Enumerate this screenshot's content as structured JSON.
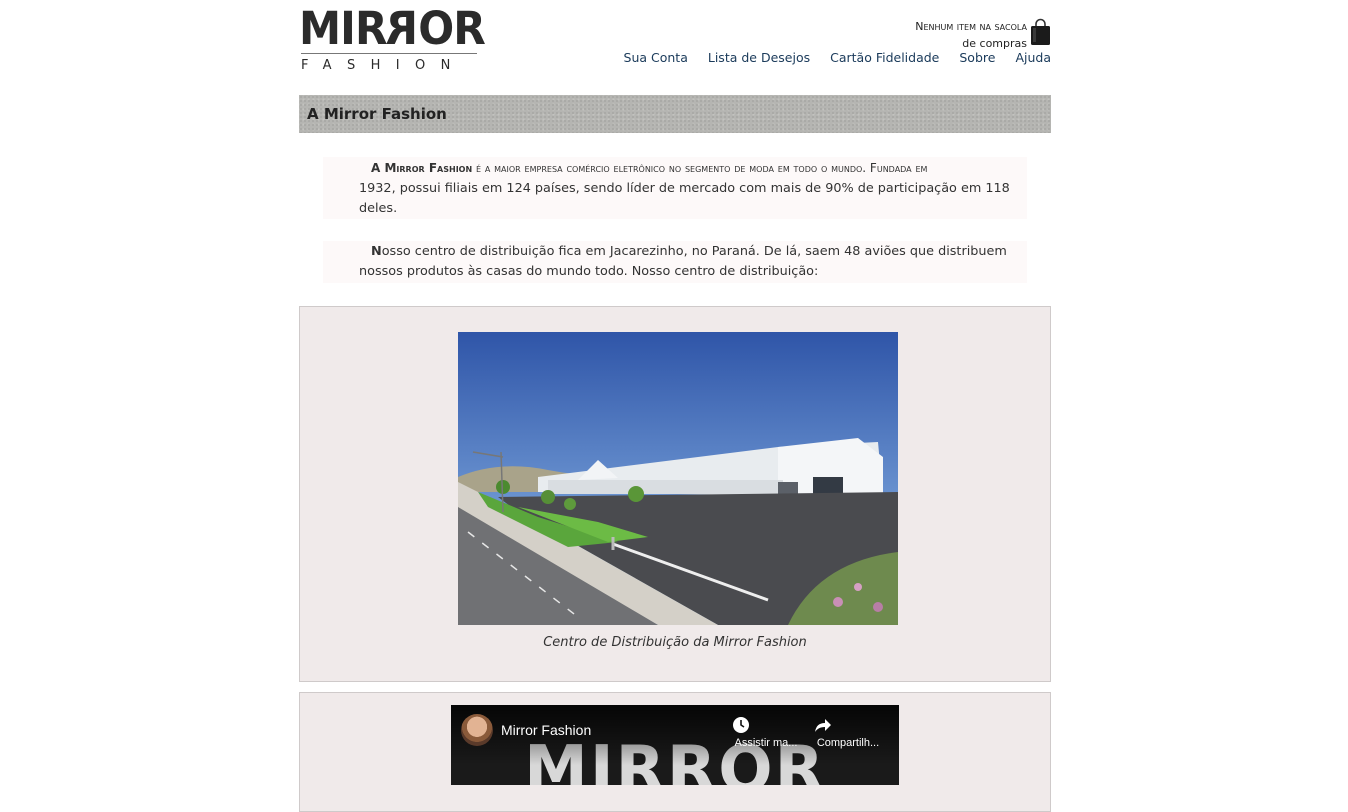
{
  "logo": {
    "top": "MIRROR",
    "bottom": "FASHION"
  },
  "cart": {
    "line1": "Nenhum item na sacola",
    "line2": "de compras"
  },
  "nav": [
    "Sua Conta",
    "Lista de Desejos",
    "Cartão Fidelidade",
    "Sobre",
    "Ajuda"
  ],
  "title": "A Mirror Fashion",
  "para1": {
    "brand": "A Mirror Fashion",
    "sc_text": " é a maior empresa comércio eletrônico no segmento de moda em todo o mundo. Fundada em",
    "rest": "1932, possui filiais em 124 países, sendo líder de mercado com mais de 90% de participação em 118 deles."
  },
  "para2": {
    "cap": "N",
    "text": "osso centro de distribuição fica em Jacarezinho, no Paraná. De lá, saem 48 aviões que distribuem nossos produtos às casas do mundo todo. Nosso centro de distribuição:"
  },
  "figure": {
    "caption": "Centro de Distribuição da Mirror Fashion"
  },
  "video": {
    "title": "Mirror Fashion",
    "watch_later": "Assistir ma...",
    "share": "Compartilh...",
    "bg_text": "MIRROR"
  }
}
